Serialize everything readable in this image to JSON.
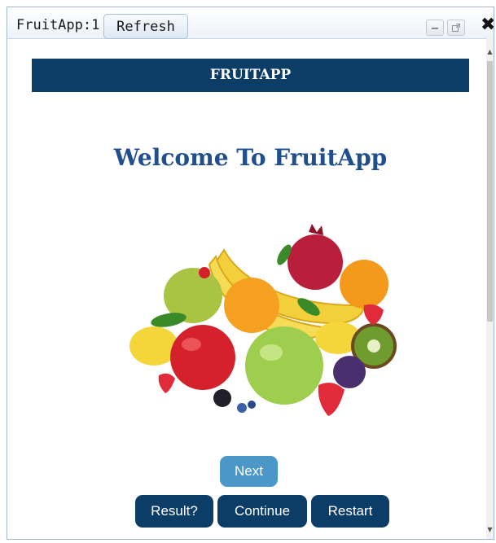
{
  "window": {
    "title": "FruitApp:1",
    "refresh_label": "Refresh",
    "minimize_icon": "minimize-icon",
    "popout_icon": "popout-icon",
    "close_icon": "close-icon",
    "close_glyph": "✖"
  },
  "app": {
    "header_title": "FRUITAPP",
    "welcome_text": "Welcome To FruitApp",
    "image_icon": "fruit-assortment-image"
  },
  "buttons": {
    "next": "Next",
    "result": "Result?",
    "continue": "Continue",
    "restart": "Restart"
  },
  "colors": {
    "header_bg": "#0c3d66",
    "welcome_text": "#214f8e",
    "next_bg": "#4a97c8",
    "action_bg": "#0c3d66"
  }
}
